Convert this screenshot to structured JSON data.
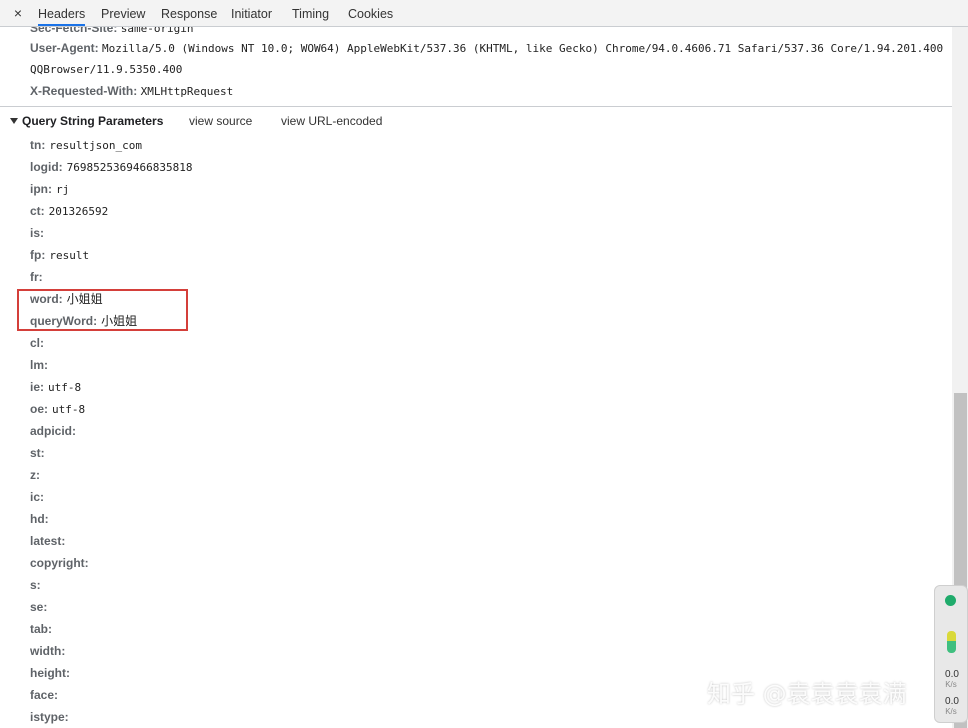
{
  "tabs": {
    "close": "×",
    "items": [
      "Headers",
      "Preview",
      "Response",
      "Initiator",
      "Timing",
      "Cookies"
    ],
    "active": "Headers"
  },
  "request_headers": [
    {
      "name": "Sec-Fetch-Site:",
      "value": "same-origin"
    },
    {
      "name": "User-Agent:",
      "value": "Mozilla/5.0 (Windows NT 10.0; WOW64) AppleWebKit/537.36 (KHTML, like Gecko) Chrome/94.0.4606.71 Safari/537.36 Core/1.94.201.400"
    },
    {
      "name": "",
      "value": "QQBrowser/11.9.5350.400"
    },
    {
      "name": "X-Requested-With:",
      "value": "XMLHttpRequest"
    }
  ],
  "query_section": {
    "title": "Query String Parameters",
    "view_source": "view source",
    "view_url_encoded": "view URL-encoded"
  },
  "params": [
    {
      "key": "tn:",
      "value": "resultjson_com"
    },
    {
      "key": "logid:",
      "value": "7698525369466835818"
    },
    {
      "key": "ipn:",
      "value": "rj"
    },
    {
      "key": "ct:",
      "value": "201326592"
    },
    {
      "key": "is:",
      "value": ""
    },
    {
      "key": "fp:",
      "value": "result"
    },
    {
      "key": "fr:",
      "value": ""
    },
    {
      "key": "word:",
      "value": "小姐姐"
    },
    {
      "key": "queryWord:",
      "value": "小姐姐"
    },
    {
      "key": "cl:",
      "value": ""
    },
    {
      "key": "lm:",
      "value": ""
    },
    {
      "key": "ie:",
      "value": "utf-8"
    },
    {
      "key": "oe:",
      "value": "utf-8"
    },
    {
      "key": "adpicid:",
      "value": ""
    },
    {
      "key": "st:",
      "value": ""
    },
    {
      "key": "z:",
      "value": ""
    },
    {
      "key": "ic:",
      "value": ""
    },
    {
      "key": "hd:",
      "value": ""
    },
    {
      "key": "latest:",
      "value": ""
    },
    {
      "key": "copyright:",
      "value": ""
    },
    {
      "key": "s:",
      "value": ""
    },
    {
      "key": "se:",
      "value": ""
    },
    {
      "key": "tab:",
      "value": ""
    },
    {
      "key": "width:",
      "value": ""
    },
    {
      "key": "height:",
      "value": ""
    },
    {
      "key": "face:",
      "value": ""
    },
    {
      "key": "istype:",
      "value": ""
    }
  ],
  "speed_widget": {
    "up": "0.0",
    "up_unit": "K/s",
    "down": "0.0",
    "down_unit": "K/s"
  },
  "watermark": "知乎 @袁袁袁袁满",
  "colors": {
    "active_tab": "#1a73e8",
    "highlight_box": "#d43f3a"
  }
}
